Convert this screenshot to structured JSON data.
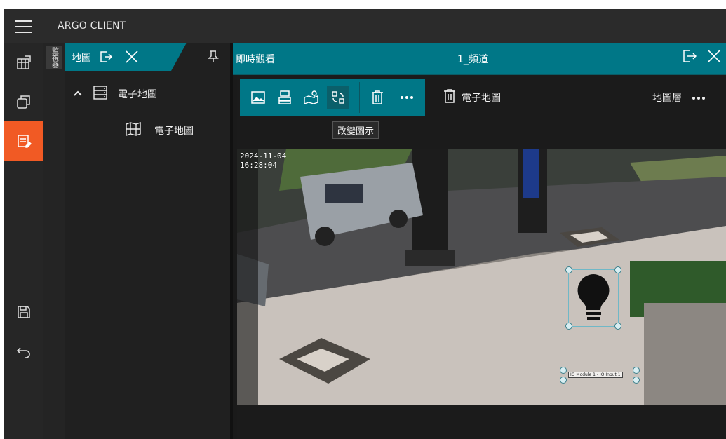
{
  "app": {
    "title": "ARGO CLIENT"
  },
  "left_nav": {
    "items": [
      {
        "name": "monitor-layout-icon"
      },
      {
        "name": "windows-icon"
      },
      {
        "name": "emap-edit-icon",
        "active": true
      },
      {
        "name": "save-icon"
      },
      {
        "name": "undo-icon"
      }
    ],
    "active_color": "#f15a24"
  },
  "side_tab": {
    "label": "監視器"
  },
  "map_panel": {
    "tab_label": "地圖",
    "tree": [
      {
        "label": "電子地圖",
        "level": 0,
        "expanded": true
      },
      {
        "label": "電子地圖",
        "level": 1
      }
    ]
  },
  "viewer": {
    "title": "即時觀看",
    "channel": "1_頻道",
    "toolbar": {
      "buttons": [
        "image-icon",
        "layout-grid-icon",
        "map-marker-icon",
        "change-icon-button",
        "trash-icon",
        "more-icon"
      ],
      "tooltip": "改變圖示",
      "context_label": "電子地圖",
      "layer_label": "地圖層"
    },
    "overlay": {
      "timestamp": "2024-11-04",
      "time": "16:28:04",
      "io_label": "IO Module 1 - IO Input 1"
    }
  },
  "colors": {
    "teal": "#007787",
    "orange": "#f15a24",
    "bg": "#1e1e1e"
  }
}
